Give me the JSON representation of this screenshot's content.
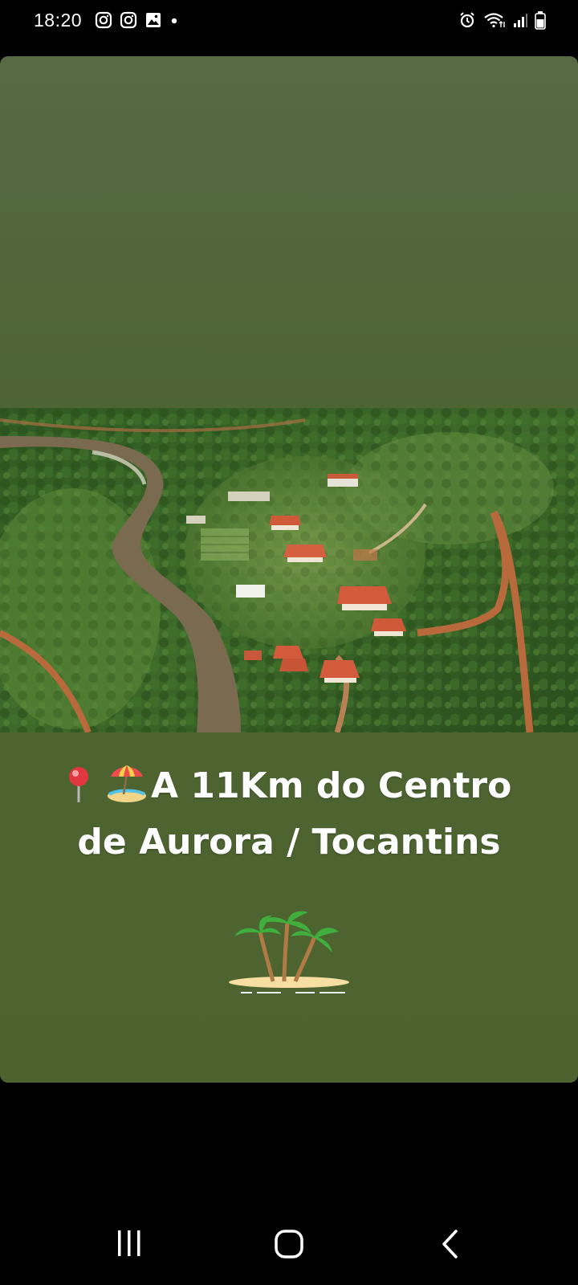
{
  "status_bar": {
    "time": "18:20",
    "left_icons": [
      "instagram-icon",
      "instagram-icon",
      "gallery-icon",
      "notification-dot-icon"
    ],
    "right_icons": [
      "alarm-icon",
      "wifi-icon",
      "signal-icon",
      "battery-icon"
    ]
  },
  "story": {
    "caption_line1": "A 11Km do Centro",
    "caption_line2": "de Aurora / Tocantins",
    "caption_emojis": [
      "round-pushpin-icon",
      "beach-umbrella-icon"
    ],
    "decoration": "palm-island-icon",
    "background_color": "#4d632f"
  },
  "nav_bar": {
    "buttons": [
      "recent-apps-button",
      "home-button",
      "back-button"
    ]
  }
}
